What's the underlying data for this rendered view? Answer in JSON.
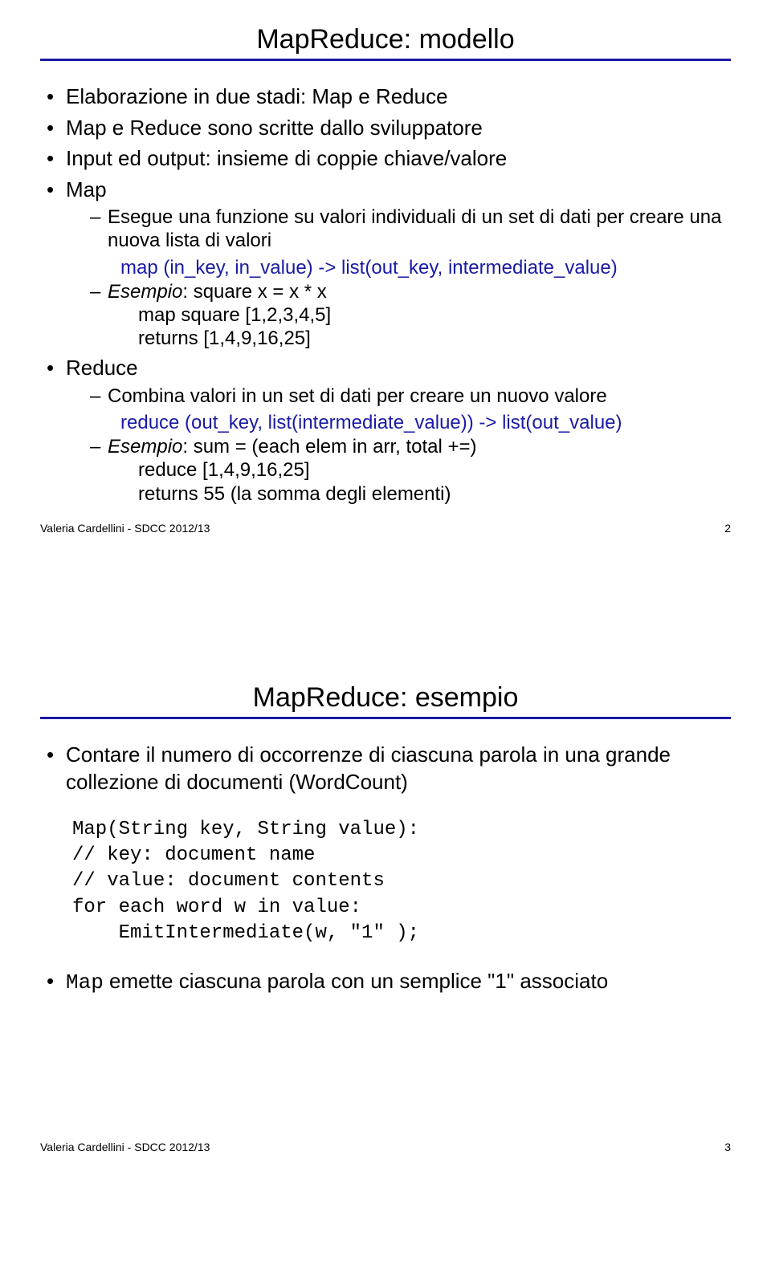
{
  "slide1": {
    "title": "MapReduce: modello",
    "b1": "Elaborazione in due stadi: Map e Reduce",
    "b2": "Map e Reduce sono scritte dallo sviluppatore",
    "b3": "Input ed output: insieme di coppie chiave/valore",
    "b4": "Map",
    "b4_1": "Esegue una funzione su valori individuali di un set di dati per creare una nuova lista di valori",
    "b4_sig": "map (in_key, in_value) -> list(out_key, intermediate_value)",
    "b4_2_label": "Esempio",
    "b4_2_rest": ": square x = x * x",
    "b4_2_l1": "map square [1,2,3,4,5]",
    "b4_2_l2": "returns [1,4,9,16,25]",
    "b5": "Reduce",
    "b5_1": "Combina valori in un set di dati per creare un nuovo valore",
    "b5_sig": "reduce (out_key, list(intermediate_value)) -> list(out_value)",
    "b5_2_label": "Esempio",
    "b5_2_rest": ": sum = (each elem in arr, total +=)",
    "b5_2_l1": "reduce [1,4,9,16,25]",
    "b5_2_l2": "returns 55 (la somma degli elementi)",
    "footer_left": "Valeria Cardellini - SDCC 2012/13",
    "footer_right": "2"
  },
  "slide2": {
    "title": "MapReduce: esempio",
    "b1": "Contare il numero di occorrenze di ciascuna parola in una grande collezione di documenti (WordCount)",
    "code": "Map(String key, String value):\n// key: document name\n// value: document contents\nfor each word w in value:\n    EmitIntermediate(w, \"1\" );",
    "b2_code": "Map",
    "b2_rest": " emette ciascuna parola con un semplice \"1\" associato",
    "footer_left": "Valeria Cardellini - SDCC 2012/13",
    "footer_right": "3"
  }
}
